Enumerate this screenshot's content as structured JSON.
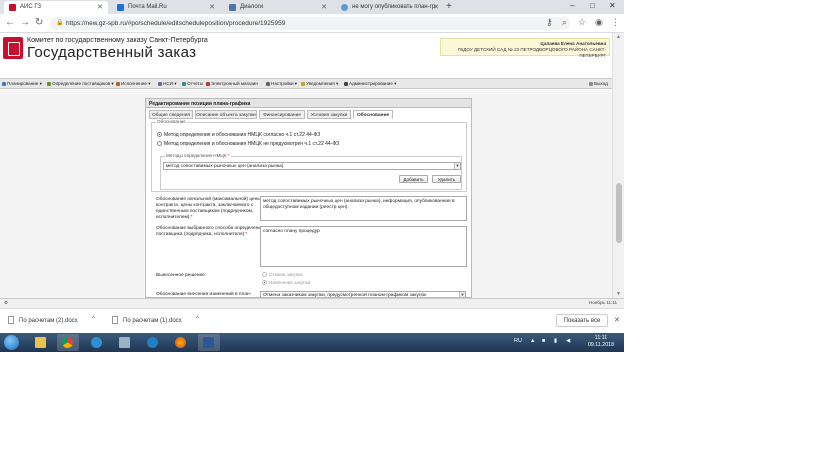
{
  "browser": {
    "tabs": [
      {
        "title": "АИС ГЗ",
        "active": true
      },
      {
        "title": "Почта Mail.Ru",
        "active": false
      },
      {
        "title": "Диалоги",
        "active": false
      },
      {
        "title": "не могу опубликовать план-гр",
        "active": false
      }
    ],
    "new_tab_label": "+",
    "url": "https://new.gz-spb.ru/#po/schedule/editscheduleposition/procedure/1925959",
    "win_minimize": "–",
    "win_maximize": "□",
    "win_close": "✕"
  },
  "site": {
    "org_line1": "Комитет по государственному заказу Санкт-Петербурга",
    "org_line2": "Государственный заказ",
    "user_name": "Цапаева Елена Анатольевна",
    "user_org": "ГБДОУ ДЕТСКИЙ САД № 23 ПЕТРОДВОРЦОВОГО РАЙОНА САНКТ-ПЕТЕРБУРГ"
  },
  "menu": {
    "items": [
      {
        "label": "Планирование",
        "color": "#3d7cc9"
      },
      {
        "label": "Определение поставщиков",
        "color": "#6a8f2a"
      },
      {
        "label": "Исполнение",
        "color": "#b5651d"
      },
      {
        "label": "НСИ",
        "color": "#7b5ea7"
      },
      {
        "label": "Отчеты",
        "color": "#2f8f8f"
      },
      {
        "label": "Электронный магазин",
        "color": "#c0392b"
      },
      {
        "label": "Настройки",
        "color": "#666666"
      },
      {
        "label": "Уведомления",
        "color": "#d4a017"
      },
      {
        "label": "Администрирование",
        "color": "#444444"
      }
    ],
    "logout": "Выход"
  },
  "panel": {
    "title": "Редактирование позиции плана-графика",
    "tabs": [
      {
        "label": "Общие сведения",
        "active": false
      },
      {
        "label": "Описание объекта закупки",
        "active": false
      },
      {
        "label": "Финансирование",
        "active": false
      },
      {
        "label": "Условия закупки",
        "active": false
      },
      {
        "label": "Обоснование",
        "active": true
      }
    ],
    "legend": "Обоснование",
    "radio1": "Метод определения и обоснования НМЦК согласно ч.1 ст.22 44-ФЗ",
    "radio2": "Метод определения и обоснования НМЦК не предусмотрен ч.1 ст.22 44-ФЗ",
    "methods_legend": "Методы определения НМЦК",
    "methods_required": "*",
    "method_value": "метод сопоставимых рыночных цен (анализа рынка)",
    "add_button": "Добавить",
    "delete_button": "Удалить",
    "field1_label": "Обоснование начальной (максимальной) цены контракта, цены контракта, заключаемого с единственным поставщиком (подрядчиком, исполнителем):",
    "field1_value": "метод сопоставимых рыночных цен (анализа рынка), информация, опубликованная в общедоступном издании (реестр цен).",
    "field2_label": "Обоснование выбранного способа определения поставщика (подрядчика, исполнителя):",
    "field2_value": "согласно плану процедур",
    "field3_label": "Вынесенное решение:",
    "decision1": "Отмена закупки",
    "decision2": "Изменение закупки",
    "field4_label": "Обоснование внесения изменений в план-",
    "field4_value": "Отмена заказчиком закупки, предусмотренной планом-графиком закупок",
    "required_mark": "*"
  },
  "status": {
    "left": "⚙",
    "right": "Ноябрь 11:11"
  },
  "downloads": {
    "items": [
      "По расчетам (2).docx",
      "По расчетам (1).docx"
    ],
    "show_all": "Показать все"
  },
  "taskbar": {
    "lang": "RU",
    "time": "11:11",
    "date": "09.11.2018"
  }
}
